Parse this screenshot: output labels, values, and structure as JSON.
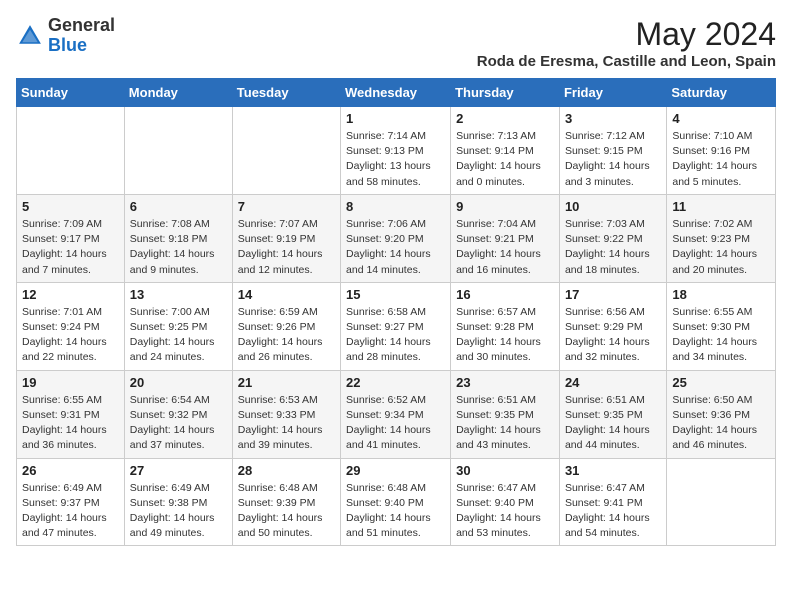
{
  "header": {
    "logo_general": "General",
    "logo_blue": "Blue",
    "month_year": "May 2024",
    "location": "Roda de Eresma, Castille and Leon, Spain"
  },
  "weekdays": [
    "Sunday",
    "Monday",
    "Tuesday",
    "Wednesday",
    "Thursday",
    "Friday",
    "Saturday"
  ],
  "weeks": [
    [
      {
        "day": "",
        "sunrise": "",
        "sunset": "",
        "daylight": ""
      },
      {
        "day": "",
        "sunrise": "",
        "sunset": "",
        "daylight": ""
      },
      {
        "day": "",
        "sunrise": "",
        "sunset": "",
        "daylight": ""
      },
      {
        "day": "1",
        "sunrise": "Sunrise: 7:14 AM",
        "sunset": "Sunset: 9:13 PM",
        "daylight": "Daylight: 13 hours and 58 minutes."
      },
      {
        "day": "2",
        "sunrise": "Sunrise: 7:13 AM",
        "sunset": "Sunset: 9:14 PM",
        "daylight": "Daylight: 14 hours and 0 minutes."
      },
      {
        "day": "3",
        "sunrise": "Sunrise: 7:12 AM",
        "sunset": "Sunset: 9:15 PM",
        "daylight": "Daylight: 14 hours and 3 minutes."
      },
      {
        "day": "4",
        "sunrise": "Sunrise: 7:10 AM",
        "sunset": "Sunset: 9:16 PM",
        "daylight": "Daylight: 14 hours and 5 minutes."
      }
    ],
    [
      {
        "day": "5",
        "sunrise": "Sunrise: 7:09 AM",
        "sunset": "Sunset: 9:17 PM",
        "daylight": "Daylight: 14 hours and 7 minutes."
      },
      {
        "day": "6",
        "sunrise": "Sunrise: 7:08 AM",
        "sunset": "Sunset: 9:18 PM",
        "daylight": "Daylight: 14 hours and 9 minutes."
      },
      {
        "day": "7",
        "sunrise": "Sunrise: 7:07 AM",
        "sunset": "Sunset: 9:19 PM",
        "daylight": "Daylight: 14 hours and 12 minutes."
      },
      {
        "day": "8",
        "sunrise": "Sunrise: 7:06 AM",
        "sunset": "Sunset: 9:20 PM",
        "daylight": "Daylight: 14 hours and 14 minutes."
      },
      {
        "day": "9",
        "sunrise": "Sunrise: 7:04 AM",
        "sunset": "Sunset: 9:21 PM",
        "daylight": "Daylight: 14 hours and 16 minutes."
      },
      {
        "day": "10",
        "sunrise": "Sunrise: 7:03 AM",
        "sunset": "Sunset: 9:22 PM",
        "daylight": "Daylight: 14 hours and 18 minutes."
      },
      {
        "day": "11",
        "sunrise": "Sunrise: 7:02 AM",
        "sunset": "Sunset: 9:23 PM",
        "daylight": "Daylight: 14 hours and 20 minutes."
      }
    ],
    [
      {
        "day": "12",
        "sunrise": "Sunrise: 7:01 AM",
        "sunset": "Sunset: 9:24 PM",
        "daylight": "Daylight: 14 hours and 22 minutes."
      },
      {
        "day": "13",
        "sunrise": "Sunrise: 7:00 AM",
        "sunset": "Sunset: 9:25 PM",
        "daylight": "Daylight: 14 hours and 24 minutes."
      },
      {
        "day": "14",
        "sunrise": "Sunrise: 6:59 AM",
        "sunset": "Sunset: 9:26 PM",
        "daylight": "Daylight: 14 hours and 26 minutes."
      },
      {
        "day": "15",
        "sunrise": "Sunrise: 6:58 AM",
        "sunset": "Sunset: 9:27 PM",
        "daylight": "Daylight: 14 hours and 28 minutes."
      },
      {
        "day": "16",
        "sunrise": "Sunrise: 6:57 AM",
        "sunset": "Sunset: 9:28 PM",
        "daylight": "Daylight: 14 hours and 30 minutes."
      },
      {
        "day": "17",
        "sunrise": "Sunrise: 6:56 AM",
        "sunset": "Sunset: 9:29 PM",
        "daylight": "Daylight: 14 hours and 32 minutes."
      },
      {
        "day": "18",
        "sunrise": "Sunrise: 6:55 AM",
        "sunset": "Sunset: 9:30 PM",
        "daylight": "Daylight: 14 hours and 34 minutes."
      }
    ],
    [
      {
        "day": "19",
        "sunrise": "Sunrise: 6:55 AM",
        "sunset": "Sunset: 9:31 PM",
        "daylight": "Daylight: 14 hours and 36 minutes."
      },
      {
        "day": "20",
        "sunrise": "Sunrise: 6:54 AM",
        "sunset": "Sunset: 9:32 PM",
        "daylight": "Daylight: 14 hours and 37 minutes."
      },
      {
        "day": "21",
        "sunrise": "Sunrise: 6:53 AM",
        "sunset": "Sunset: 9:33 PM",
        "daylight": "Daylight: 14 hours and 39 minutes."
      },
      {
        "day": "22",
        "sunrise": "Sunrise: 6:52 AM",
        "sunset": "Sunset: 9:34 PM",
        "daylight": "Daylight: 14 hours and 41 minutes."
      },
      {
        "day": "23",
        "sunrise": "Sunrise: 6:51 AM",
        "sunset": "Sunset: 9:35 PM",
        "daylight": "Daylight: 14 hours and 43 minutes."
      },
      {
        "day": "24",
        "sunrise": "Sunrise: 6:51 AM",
        "sunset": "Sunset: 9:35 PM",
        "daylight": "Daylight: 14 hours and 44 minutes."
      },
      {
        "day": "25",
        "sunrise": "Sunrise: 6:50 AM",
        "sunset": "Sunset: 9:36 PM",
        "daylight": "Daylight: 14 hours and 46 minutes."
      }
    ],
    [
      {
        "day": "26",
        "sunrise": "Sunrise: 6:49 AM",
        "sunset": "Sunset: 9:37 PM",
        "daylight": "Daylight: 14 hours and 47 minutes."
      },
      {
        "day": "27",
        "sunrise": "Sunrise: 6:49 AM",
        "sunset": "Sunset: 9:38 PM",
        "daylight": "Daylight: 14 hours and 49 minutes."
      },
      {
        "day": "28",
        "sunrise": "Sunrise: 6:48 AM",
        "sunset": "Sunset: 9:39 PM",
        "daylight": "Daylight: 14 hours and 50 minutes."
      },
      {
        "day": "29",
        "sunrise": "Sunrise: 6:48 AM",
        "sunset": "Sunset: 9:40 PM",
        "daylight": "Daylight: 14 hours and 51 minutes."
      },
      {
        "day": "30",
        "sunrise": "Sunrise: 6:47 AM",
        "sunset": "Sunset: 9:40 PM",
        "daylight": "Daylight: 14 hours and 53 minutes."
      },
      {
        "day": "31",
        "sunrise": "Sunrise: 6:47 AM",
        "sunset": "Sunset: 9:41 PM",
        "daylight": "Daylight: 14 hours and 54 minutes."
      },
      {
        "day": "",
        "sunrise": "",
        "sunset": "",
        "daylight": ""
      }
    ]
  ]
}
